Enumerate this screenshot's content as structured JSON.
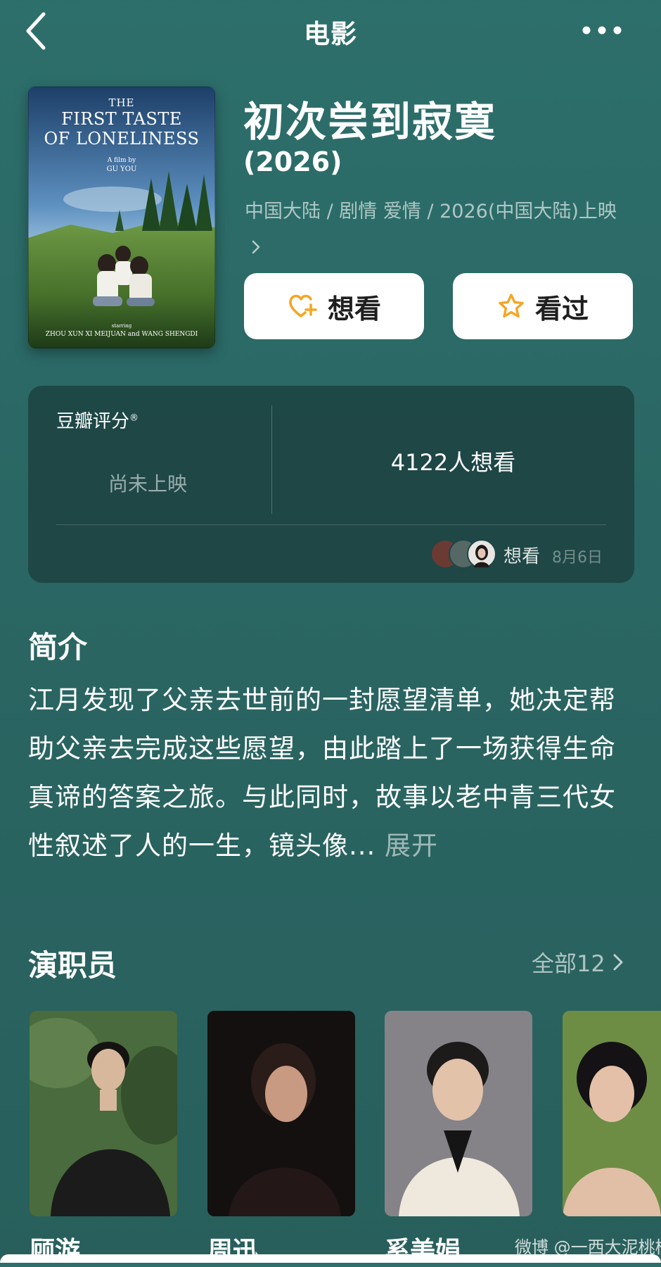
{
  "nav": {
    "title": "电影"
  },
  "poster": {
    "the": "THE",
    "line1": "FIRST TASTE",
    "line2": "OF LONELINESS",
    "film_by": "A film by",
    "director": "GU YOU",
    "starring": "starring",
    "cast_line": "ZHOU XUN XI MEIJUAN and WANG SHENGDI"
  },
  "movie": {
    "title": "初次尝到寂寞",
    "year": "(2026)",
    "meta": "中国大陆 / 剧情 爱情 / 2026(中国大陆)上映"
  },
  "actions": {
    "want_label": "想看",
    "watched_label": "看过"
  },
  "rating": {
    "label": "豆瓣评分",
    "registered": "®",
    "status": "尚未上映",
    "want_count": "4122人想看",
    "friend_action": "想看",
    "friend_date": "8月6日"
  },
  "synopsis": {
    "heading": "简介",
    "text": "江月发现了父亲去世前的一封愿望清单，她决定帮助父亲去完成这些愿望，由此踏上了一场获得生命真谛的答案之旅。与此同时，故事以老中青三代女性叙述了人的一生，镜头像...",
    "expand": " 展开"
  },
  "cast": {
    "heading": "演职员",
    "all_label": "全部12",
    "members": [
      {
        "name": "顾游"
      },
      {
        "name": "周迅"
      },
      {
        "name": "奚美娟"
      },
      {
        "name": ""
      }
    ]
  },
  "watermark": "微博 @一西大泥桃桃",
  "colors": {
    "background": "#2d6f6b",
    "card": "#1f4a4a",
    "button_bg": "#ffffff",
    "icon_orange": "#f5a623"
  }
}
